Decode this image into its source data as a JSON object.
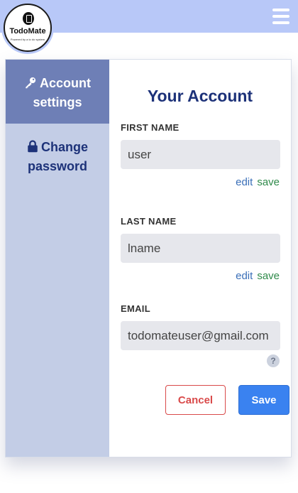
{
  "app": {
    "logo_title": "TodoMate",
    "logo_tagline": "Powered by a to do system"
  },
  "sidebar": {
    "items": [
      {
        "label_line1": "Account",
        "label_line2": "settings",
        "icon": "key-icon",
        "active": true
      },
      {
        "label_line1": "Change",
        "label_line2": "password",
        "icon": "lock-icon",
        "active": false
      }
    ]
  },
  "account": {
    "title": "Your Account",
    "first_name": {
      "label": "FIRST NAME",
      "value": "user",
      "edit": "edit",
      "save": "save"
    },
    "last_name": {
      "label": "LAST NAME",
      "value": "lname",
      "edit": "edit",
      "save": "save"
    },
    "email": {
      "label": "EMAIL",
      "value": "todomateuser@gmail.com",
      "help": "?"
    },
    "cancel_label": "Cancel",
    "save_label": "Save"
  },
  "colors": {
    "topbar": "#b8c8f8",
    "sidebar": "#c3cde6",
    "sidebar_active": "#6e7fb6",
    "heading": "#1d3279",
    "cancel": "#d94a4a",
    "save": "#3a82f0"
  }
}
